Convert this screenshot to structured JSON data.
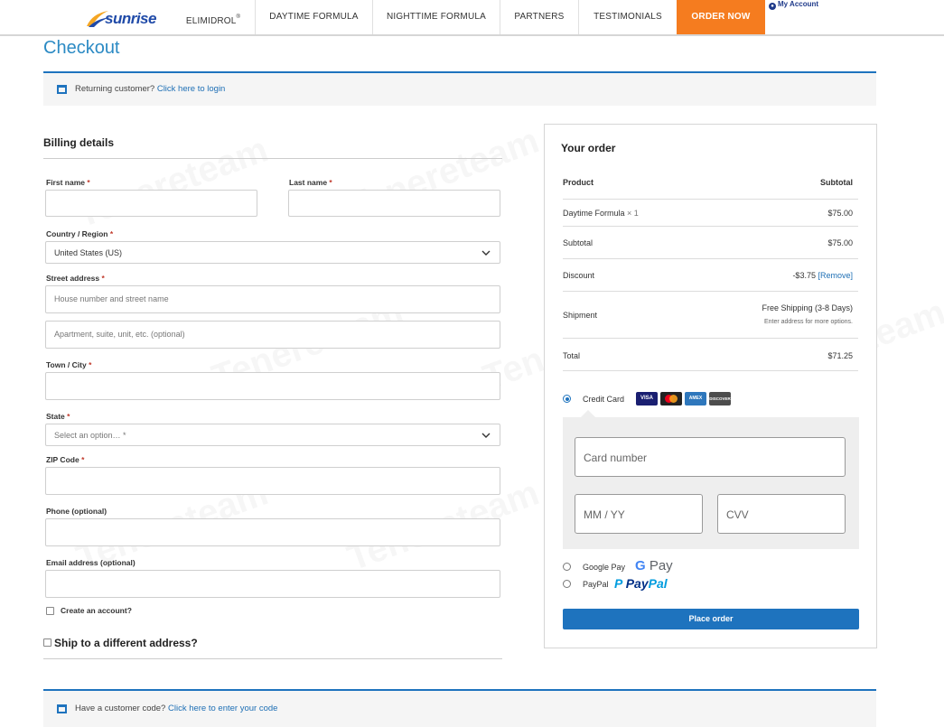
{
  "header": {
    "logo_text": "sunrise",
    "nav": {
      "elimidrol": "ELIMIDROL",
      "elimidrol_mark": "®",
      "daytime": "DAYTIME FORMULA",
      "nighttime": "NIGHTTIME FORMULA",
      "partners": "PARTNERS",
      "testimonials": "TESTIMONIALS",
      "order_now": "ORDER NOW"
    },
    "my_account": "My Account",
    "accent_color": "#f57c1f"
  },
  "page_title": "Checkout",
  "notice_login": {
    "text": "Returning customer?",
    "link": "Click here to login"
  },
  "billing": {
    "heading": "Billing details",
    "required_mark": "*",
    "first_name_label": "First name",
    "last_name_label": "Last name",
    "country_label": "Country / Region",
    "country_value": "United States (US)",
    "street_label": "Street address",
    "street_placeholder": "House number and street name",
    "apartment_placeholder": "Apartment, suite, unit, etc. (optional)",
    "city_label": "Town / City",
    "state_label": "State",
    "state_value": "Select an option… *",
    "zip_label": "ZIP Code",
    "phone_label": "Phone (optional)",
    "email_label": "Email address (optional)",
    "create_account_label": "Create an account?",
    "ship_different_label": "Ship to a different address?"
  },
  "order": {
    "title": "Your order",
    "col_product": "Product",
    "col_subtotal": "Subtotal",
    "item_name": "Daytime Formula",
    "item_qty": "× 1",
    "item_price": "$75.00",
    "subtotal_label": "Subtotal",
    "subtotal_value": "$75.00",
    "discount_label": "Discount",
    "discount_value": "-$3.75",
    "discount_remove": "[Remove]",
    "shipment_label": "Shipment",
    "shipment_value": "Free Shipping (3-8 Days)",
    "shipment_note": "Enter address for more options.",
    "total_label": "Total",
    "total_value": "$71.25"
  },
  "payment": {
    "credit_card_label": "Credit Card",
    "card_logos": [
      "VISA",
      "MC",
      "AMEX",
      "DISCOVER"
    ],
    "card_number_placeholder": "Card number",
    "expiry_placeholder": "MM / YY",
    "cvv_placeholder": "CVV",
    "google_pay_label": "Google Pay",
    "google_pay_logo": "G Pay",
    "paypal_label": "PayPal",
    "paypal_logo": "PayPal",
    "place_order": "Place order",
    "selected": "Credit Card",
    "primary_color": "#1e73be"
  },
  "notice_coupon": {
    "text": "Have a customer code?",
    "link": "Click here to enter your code"
  },
  "watermark": "Tenereteam"
}
